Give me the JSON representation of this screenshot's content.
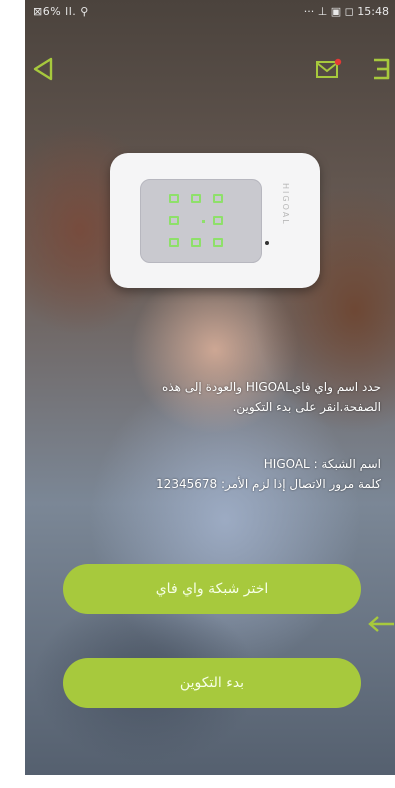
{
  "status": {
    "left": "⊠6% ⅼⅼ. ⚲",
    "right": "··· ⊥ ▣ ◻ 15:48"
  },
  "colors": {
    "accent": "#a7c93d"
  },
  "device": {
    "brand": "HIGOAL"
  },
  "instructions": {
    "line1": "حدد اسم واي فاي‪HIGOAL‬ والعودة إلى هذه",
    "line2": "الصفحة.انقر على بدء التكوين."
  },
  "network": {
    "name_line": "اسم الشبكة : HIGOAL",
    "password_line": "كلمة مرور الاتصال إذا لزم الأمر: 12345678"
  },
  "buttons": {
    "choose_wifi": "اختر شبكة واي فاي",
    "start_config": "بدء التكوين"
  },
  "icons": {
    "back": "back-triangle-icon",
    "mail": "mail-icon",
    "menu": "menu-icon",
    "arrow": "arrow-left-icon"
  }
}
